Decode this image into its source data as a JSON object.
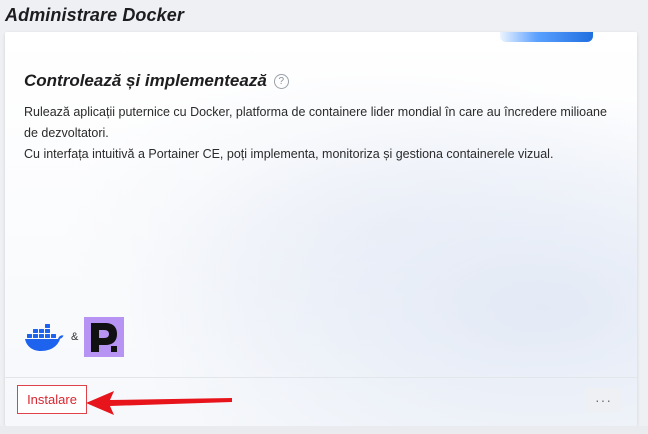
{
  "window": {
    "title": "Administrare Docker"
  },
  "card": {
    "headline": "Controlează și implementează",
    "help_icon": "question-circle-icon",
    "description_line1": "Rulează aplicații puternice cu Docker, platforma de containere lider mondial în care au încredere milioane de dezvoltatori.",
    "description_line2": "Cu interfața intuitivă a Portainer CE, poți implementa, monitoriza și gestiona containerele vizual.",
    "logos": {
      "left": "docker-logo",
      "separator": "&",
      "right": "portainer-logo"
    }
  },
  "footer": {
    "install_label": "Instalare",
    "more_label": "···"
  },
  "colors": {
    "accent": "#1f6fe0",
    "install_red": "#d7262f",
    "docker_blue": "#1d63ed",
    "portainer_purple": "#b794f4",
    "arrow_red": "#e8141c"
  }
}
